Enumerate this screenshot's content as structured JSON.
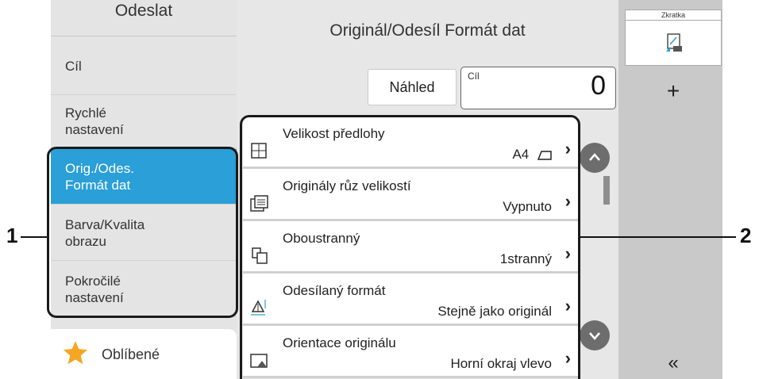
{
  "sidebar": {
    "header": "Odeslat",
    "items": [
      {
        "label": "Cíl"
      },
      {
        "label": "Rychlé\nnastavení"
      },
      {
        "label": "Orig./Odes.\nFormát dat"
      },
      {
        "label": "Barva/Kvalita\nobrazu"
      },
      {
        "label": "Pokročilé\nnastavení"
      }
    ],
    "active_index": 2,
    "favorites_label": "Oblíbené"
  },
  "main": {
    "title": "Originál/Odesíl Formát dat",
    "preview_label": "Náhled",
    "destination": {
      "label": "Cíl",
      "count": "0"
    },
    "rows": [
      {
        "title": "Velikost předlohy",
        "value": "A4",
        "icon": "original-size-icon"
      },
      {
        "title": "Originály růz velikostí",
        "value": "Vypnuto",
        "icon": "mixed-originals-icon"
      },
      {
        "title": "Oboustranný",
        "value": "1stranný",
        "icon": "duplex-icon"
      },
      {
        "title": "Odesílaný formát",
        "value": "Stejně jako originál",
        "icon": "sending-size-icon"
      },
      {
        "title": "Orientace originálu",
        "value": "Horní okraj vlevo",
        "icon": "orientation-icon"
      }
    ]
  },
  "rail": {
    "shortcut_label": "Zkratka",
    "add_label": "+",
    "collapse_label": "«"
  },
  "callouts": {
    "left": "1",
    "right": "2"
  },
  "colors": {
    "accent": "#2a9fd8",
    "sidebar_bg": "#e4e4e4",
    "main_bg": "#e7e7e7",
    "rail_bg": "#c9c9c9",
    "star": "#f5a623"
  }
}
